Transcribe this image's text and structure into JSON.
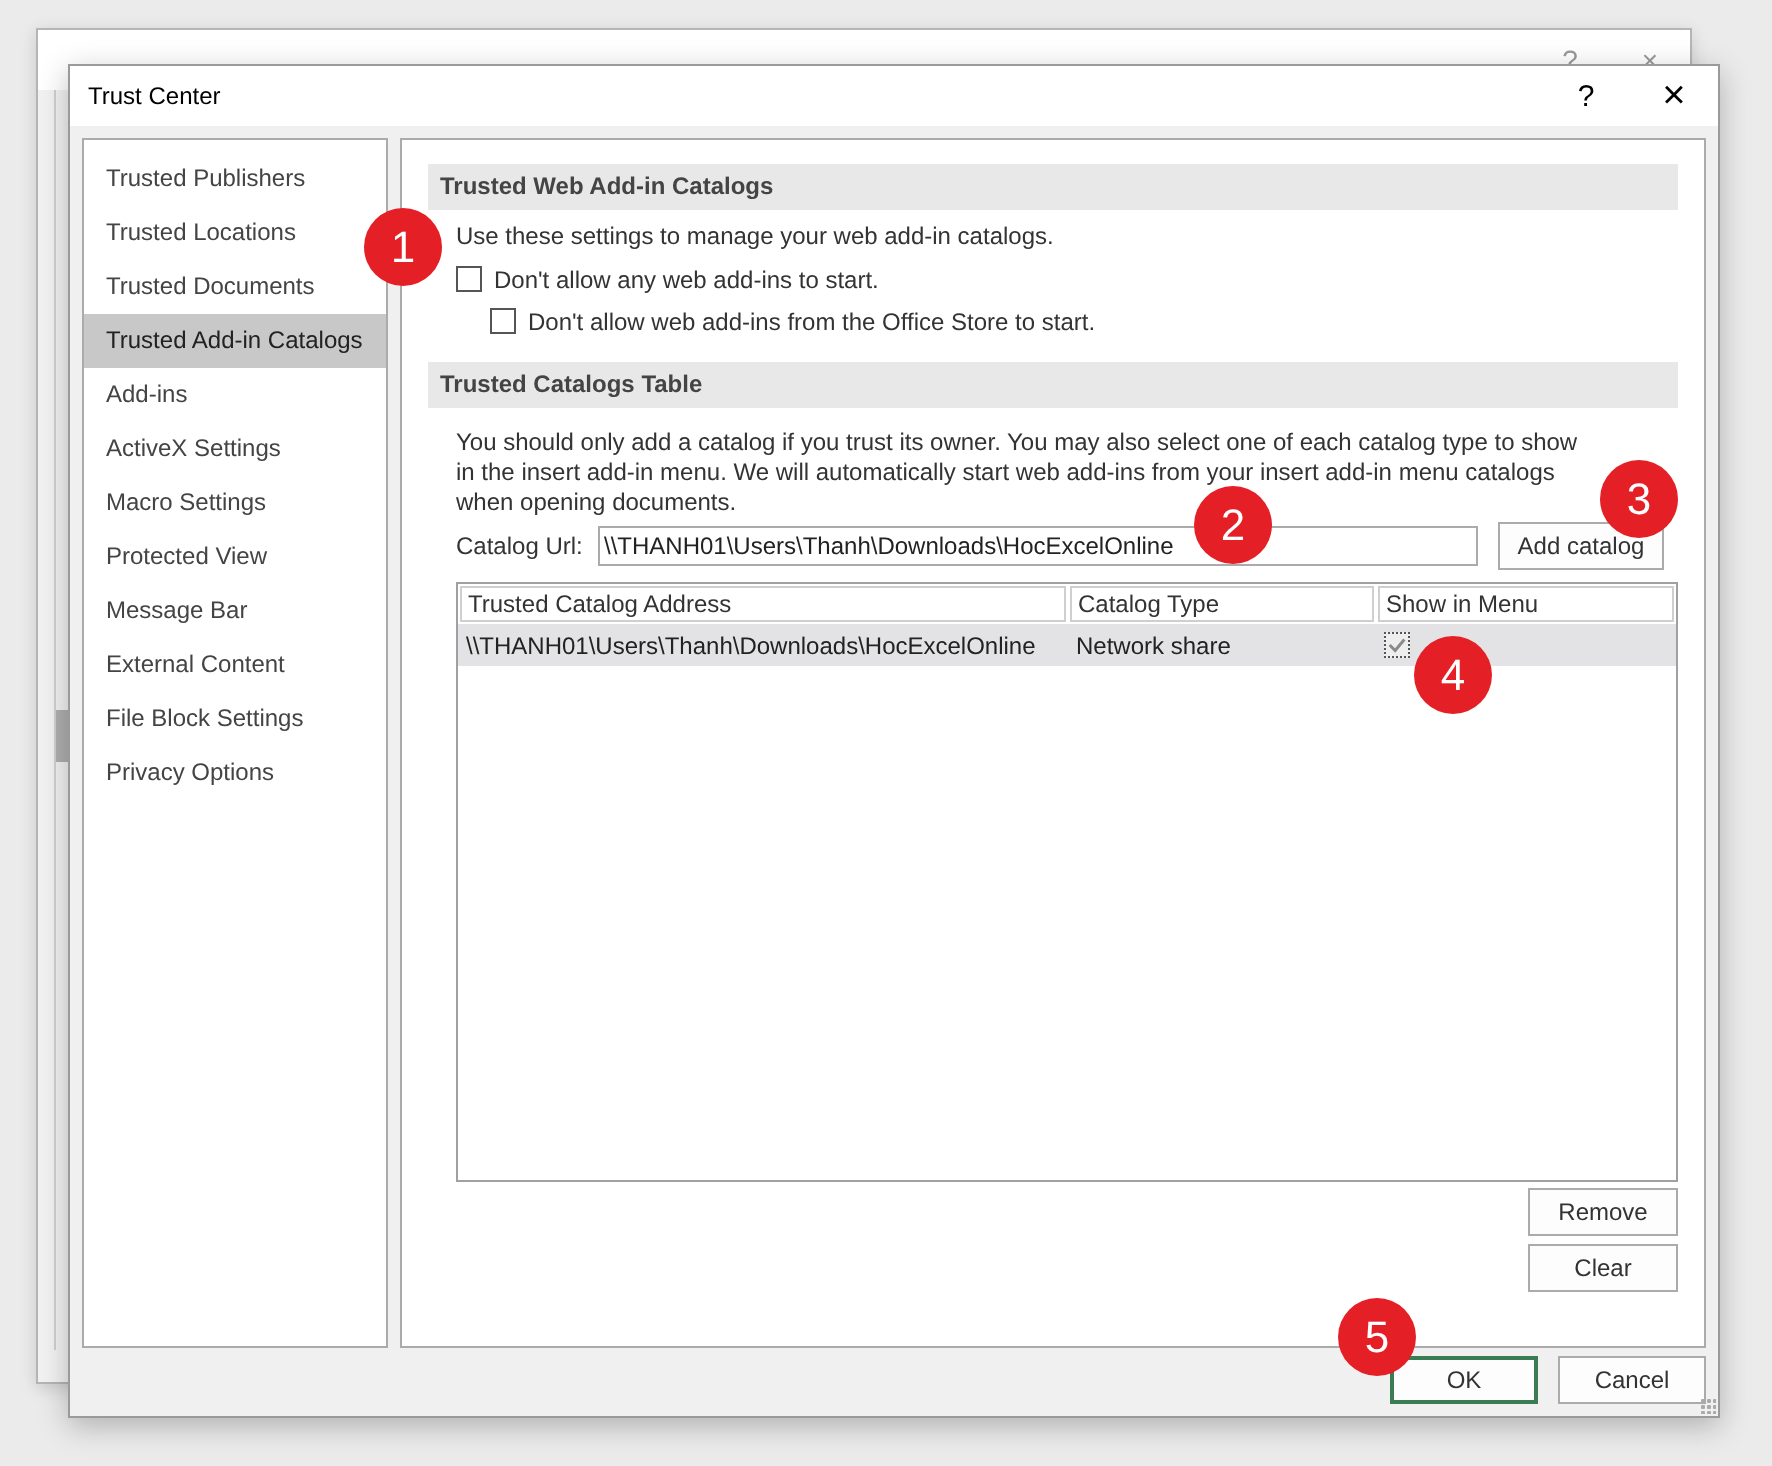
{
  "background_window": {
    "help": "?",
    "close": "×"
  },
  "dialog": {
    "title": "Trust Center",
    "help": "?",
    "close": "×"
  },
  "sidebar": {
    "items": [
      {
        "label": "Trusted Publishers",
        "selected": false
      },
      {
        "label": "Trusted Locations",
        "selected": false
      },
      {
        "label": "Trusted Documents",
        "selected": false
      },
      {
        "label": "Trusted Add-in Catalogs",
        "selected": true
      },
      {
        "label": "Add-ins",
        "selected": false
      },
      {
        "label": "ActiveX Settings",
        "selected": false
      },
      {
        "label": "Macro Settings",
        "selected": false
      },
      {
        "label": "Protected View",
        "selected": false
      },
      {
        "label": "Message Bar",
        "selected": false
      },
      {
        "label": "External Content",
        "selected": false
      },
      {
        "label": "File Block Settings",
        "selected": false
      },
      {
        "label": "Privacy Options",
        "selected": false
      }
    ]
  },
  "web_catalogs": {
    "heading": "Trusted Web Add-in Catalogs",
    "intro": "Use these settings to manage your web add-in catalogs.",
    "options": [
      {
        "label": "Don't allow any web add-ins to start.",
        "checked": false,
        "badge": "1",
        "children": [
          {
            "label": "Don't allow web add-ins from the Office Store to start.",
            "checked": false
          }
        ]
      }
    ]
  },
  "catalogs_table": {
    "heading": "Trusted Catalogs Table",
    "description": "You should only add a catalog if you trust its owner. You may also select one of each catalog type to show in the insert add-in menu. We will automatically start web add-ins from your insert add-in menu catalogs when opening documents.",
    "url_field": {
      "label": "Catalog Url:",
      "value": "\\\\THANH01\\Users\\Thanh\\Downloads\\HocExcelOnline",
      "badge": "2"
    },
    "add_button": {
      "label": "Add catalog",
      "badge": "3"
    },
    "table": {
      "columns": [
        "Trusted Catalog Address",
        "Catalog Type",
        "Show in Menu"
      ],
      "rows": [
        {
          "address": "\\\\THANH01\\Users\\Thanh\\Downloads\\HocExcelOnline",
          "type": "Network share",
          "show_in_menu": true,
          "selected": true,
          "badge": "4"
        }
      ]
    },
    "buttons": [
      {
        "label": "Remove"
      },
      {
        "label": "Clear"
      }
    ]
  },
  "footer_buttons": [
    {
      "label": "OK",
      "default": true,
      "badge": "5"
    },
    {
      "label": "Cancel",
      "default": false
    }
  ]
}
